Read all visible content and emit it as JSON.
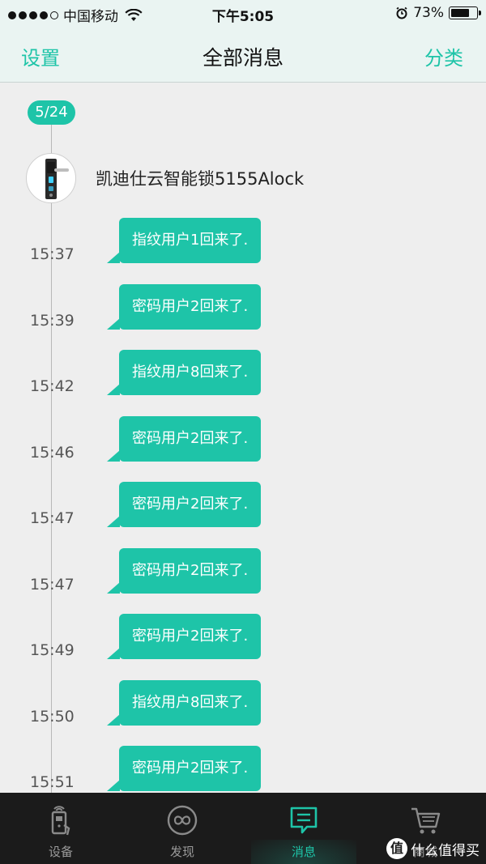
{
  "status_bar": {
    "carrier": "中国移动",
    "time": "下午5:05",
    "battery_percent": "73%",
    "battery_level": 0.73,
    "signal_bars": 4
  },
  "nav": {
    "left": "设置",
    "title": "全部消息",
    "right": "分类"
  },
  "timeline": {
    "date": "5/24",
    "device_name": "凯迪仕云智能锁5155Alock",
    "messages": [
      {
        "time": "15:37",
        "text": "指纹用户1回来了."
      },
      {
        "time": "15:39",
        "text": "密码用户2回来了."
      },
      {
        "time": "15:42",
        "text": "指纹用户8回来了."
      },
      {
        "time": "15:46",
        "text": "密码用户2回来了."
      },
      {
        "time": "15:47",
        "text": "密码用户2回来了."
      },
      {
        "time": "15:47",
        "text": "密码用户2回来了."
      },
      {
        "time": "15:49",
        "text": "密码用户2回来了."
      },
      {
        "time": "15:50",
        "text": "指纹用户8回来了."
      },
      {
        "time": "15:51",
        "text": "密码用户2回来了."
      }
    ]
  },
  "tabs": [
    {
      "label": "设备",
      "icon": "device-icon"
    },
    {
      "label": "发现",
      "icon": "discover-icon"
    },
    {
      "label": "消息",
      "icon": "message-icon",
      "active": true
    },
    {
      "label": "商城",
      "icon": "cart-icon"
    }
  ],
  "colors": {
    "accent": "#1ec4a8",
    "tabbar": "#1b1b1b",
    "background": "#eeeeee"
  },
  "watermark": {
    "icon_text": "值",
    "text": "什么值得买"
  }
}
